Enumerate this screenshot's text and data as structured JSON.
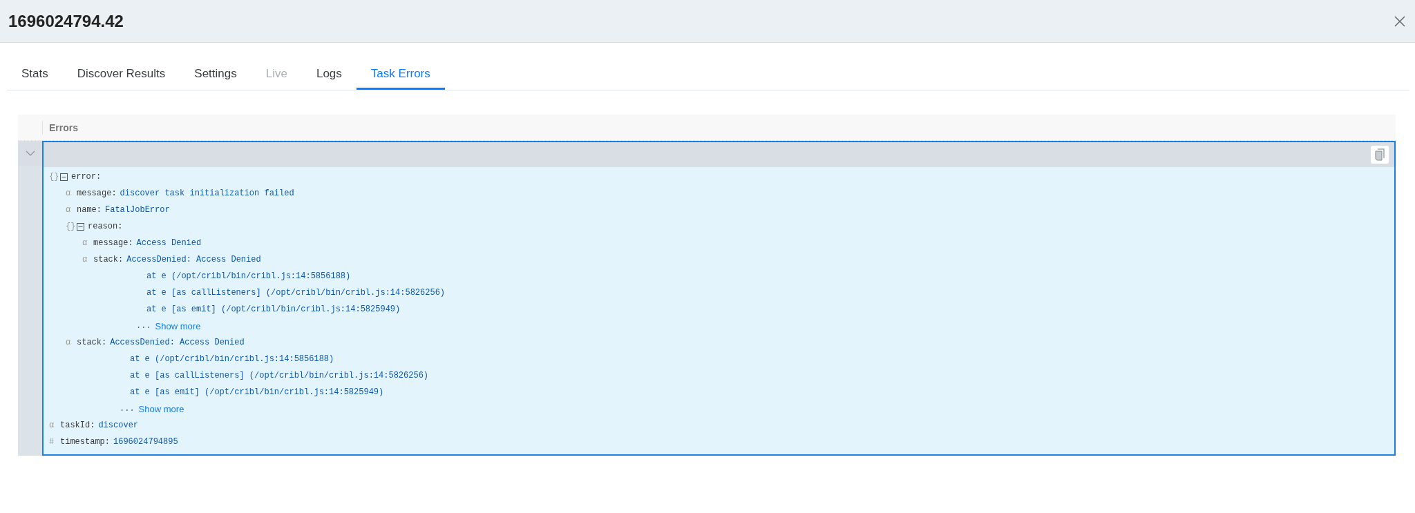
{
  "window": {
    "title": "1696024794.42"
  },
  "tabs": [
    {
      "label": "Stats",
      "selected": false,
      "disabled": false
    },
    {
      "label": "Discover Results",
      "selected": false,
      "disabled": false
    },
    {
      "label": "Settings",
      "selected": false,
      "disabled": false
    },
    {
      "label": "Live",
      "selected": false,
      "disabled": true
    },
    {
      "label": "Logs",
      "selected": false,
      "disabled": false
    },
    {
      "label": "Task Errors",
      "selected": true,
      "disabled": false
    }
  ],
  "table": {
    "columns": [
      "Errors"
    ],
    "rows": [
      {
        "expanded": true,
        "entries": [
          {
            "kind": "object",
            "icon": "{}",
            "key": "error:",
            "expanded": true,
            "children": [
              {
                "kind": "string",
                "icon": "α",
                "key": "message:",
                "value": "discover task initialization failed"
              },
              {
                "kind": "string",
                "icon": "α",
                "key": "name:",
                "value": "FatalJobError"
              },
              {
                "kind": "object",
                "icon": "{}",
                "key": "reason:",
                "expanded": true,
                "children": [
                  {
                    "kind": "string",
                    "icon": "α",
                    "key": "message:",
                    "value": "Access Denied"
                  },
                  {
                    "kind": "string",
                    "icon": "α",
                    "key": "stack:",
                    "value": "AccessDenied: Access Denied",
                    "lines": [
                      "at e (/opt/cribl/bin/cribl.js:14:5856188)",
                      "at e [as callListeners] (/opt/cribl/bin/cribl.js:14:5826256)",
                      "at e [as emit] (/opt/cribl/bin/cribl.js:14:5825949)"
                    ],
                    "ellipsis": "...",
                    "show_more": "Show more"
                  }
                ]
              },
              {
                "kind": "string",
                "icon": "α",
                "key": "stack:",
                "value": "AccessDenied: Access Denied",
                "lines": [
                  "at e (/opt/cribl/bin/cribl.js:14:5856188)",
                  "at e [as callListeners] (/opt/cribl/bin/cribl.js:14:5826256)",
                  "at e [as emit] (/opt/cribl/bin/cribl.js:14:5825949)"
                ],
                "ellipsis": "...",
                "show_more": "Show more"
              }
            ]
          },
          {
            "kind": "string",
            "icon": "α",
            "key": "taskId:",
            "value": "discover"
          },
          {
            "kind": "number",
            "icon": "#",
            "key": "timestamp:",
            "value": "1696024794895"
          }
        ]
      }
    ]
  }
}
